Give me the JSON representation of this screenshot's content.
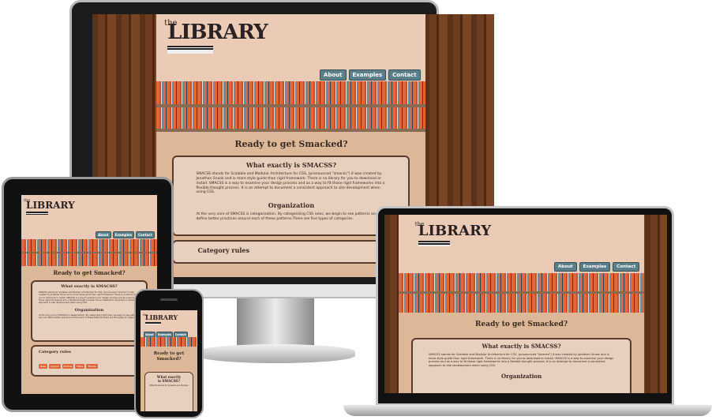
{
  "site": {
    "logo_the": "the",
    "logo_word": "LIBRARY",
    "nav": [
      "About",
      "Examples",
      "Contact"
    ],
    "hero_title": "Ready to get Smacked?",
    "hero_title_phone_1": "Ready to get",
    "hero_title_phone_2": "Smacked?",
    "what_title": "What exactly is SMACSS?",
    "what_body": "SMACSS stands for Scalable and Modular Architecture for CSS, (pronounced \"smacks\") it was created by Jonathan Snook and is more style guide than rigid framework. There is no library for you to download or install. SMACSS is a way to examine your design process and as a way to fit those rigid frameworks into a flexible thought process. It is an attempt to document a consistent approach to site development when using CSS.",
    "org_title": "Organization",
    "org_body": "At the very core of SMACSS is categorization. By categorizing CSS rules, we begin to see patterns and can define better practices around each of these patterns.There are five types of categories.",
    "cat_title": "Category rules",
    "cat_buttons": [
      "Base",
      "Layout",
      "Module",
      "State",
      "Theme"
    ],
    "phone_what_title_1": "What exactly",
    "phone_what_title_2": "is SMACSS?",
    "phone_body": "SMACSS stands for Scalable and Modular"
  },
  "colors": {
    "page_bg": "#eccbb6",
    "nav_button": "#5b7f8a",
    "book_orange": "#e0663d",
    "wood": "#5a3119"
  }
}
